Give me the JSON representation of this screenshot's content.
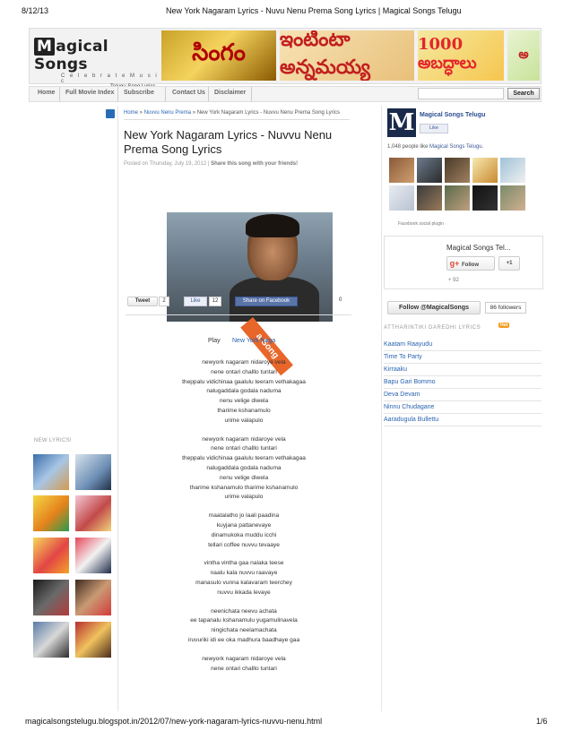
{
  "print_header": {
    "date": "8/12/13",
    "title": "New York Nagaram Lyrics - Nuvu Nenu Prema Song Lyrics | Magical Songs Telugu"
  },
  "print_footer": {
    "url": "magicalsongstelugu.blogspot.in/2012/07/new-york-nagaram-lyrics-nuvvu-nenu.html",
    "page": "1/6"
  },
  "logo": {
    "m": "M",
    "rest": "agical Songs",
    "tagline": "C e l e b r a t e   M u s i c",
    "sub": "Telugu Song Lyrics"
  },
  "banners": [
    "సింగం",
    "ఇంటింటా అన్నమయ్య",
    "1000 అబద్ధాలు",
    "అ"
  ],
  "nav": {
    "items": [
      "Home",
      "Full Movie Index",
      "Subscribe",
      "Contact Us",
      "Disclaimer"
    ],
    "search_label": "Search"
  },
  "breadcrumb": {
    "home": "Home",
    "sep1": " » ",
    "category": "Nuvvu Nenu Prema",
    "sep2": " » ",
    "current": "New York Nagaram Lyrics - Nuvvu Nenu Prema Song Lyrics"
  },
  "post": {
    "title": "New York Nagaram Lyrics - Nuvvu Nenu Prema Song Lyrics",
    "meta_prefix": "Posted on Thursday, July 19, 2012 | ",
    "meta_share": "Share this song with your friends!"
  },
  "share": {
    "tweet": "Tweet",
    "tweet_count": "2",
    "like": "Like",
    "like_count": "12",
    "fb_share": "Share on Facebook",
    "share_count": "0"
  },
  "ribbon": "a Song",
  "play": {
    "label": "Play",
    "song": "New York Naga"
  },
  "lyrics": [
    [
      "newyork nagaram nidaroye vela",
      "nene ontari challlo tuntari",
      "theppalu vidichinaa gaalulu teeram vethakagaa",
      "nalugaddala godala naduma",
      "nenu velige diwela",
      "tharime kshanamulo",
      "urime valapulo"
    ],
    [
      "newyork nagaram nidaroye vela",
      "nene ontari challlo tuntari",
      "theppalu vidichinaa gaalulu teeram vethakagaa",
      "nalugaddala godala naduma",
      "nenu velige diwela",
      "tharime kshanamulo tharime kshanamulo",
      "urime valapulo"
    ],
    [
      "maatalatho jo laali paadina",
      "kuyjana pattanevaye",
      "dinamukoka muddu icchi",
      "tellari coffee nuvvu tevaaye"
    ],
    [
      "vintha vintha gaa nalaka teese",
      "naalu kala nuvvu raavaye",
      "manasulo vunna kalavaram teerchey",
      "nuvvu ikkada levaye"
    ],
    [
      "neenichata neevu achata",
      "ee tapanalu kshanamulu yugamulinavela",
      "ningichata neelamachata",
      "iruvuriki idi ee oka madhura baadhaye gaa"
    ],
    [
      "newyork nagaram nidaroye vela",
      "nene ontari challlo tuntari"
    ]
  ],
  "sidebar_left": {
    "heading": "NEW LYRICS!"
  },
  "fb": {
    "logo_letter": "M",
    "page_name": "Magical Songs Telugu",
    "like_label": "Like",
    "count_prefix": "1,048 people like ",
    "count_link": "Magical Songs Telugu",
    "count_suffix": ".",
    "plugin": "Facebook social plugin"
  },
  "gplus": {
    "name": "Magical Songs Tel...",
    "g_label": "g+",
    "follow_label": "Follow",
    "plus_one": "+1",
    "count": "+ 92"
  },
  "twitter": {
    "follow_label": "Follow @MagicalSongs",
    "followers": "86 followers"
  },
  "hot_list": {
    "heading": "ATTHARINTIKI DAREDHI LYRICS",
    "badge": "Hot",
    "items": [
      "Kaatam Raayudu",
      "Time To Party",
      "Kirraaku",
      "Bapu Gari Bommo",
      "Deva Devam",
      "Ninnu Chudagane",
      "Aaradugula Bullettu"
    ]
  },
  "colors": {
    "link": "#2a64b0",
    "orange_ribbon": "#e8662a",
    "fb_blue": "#3b5998"
  }
}
